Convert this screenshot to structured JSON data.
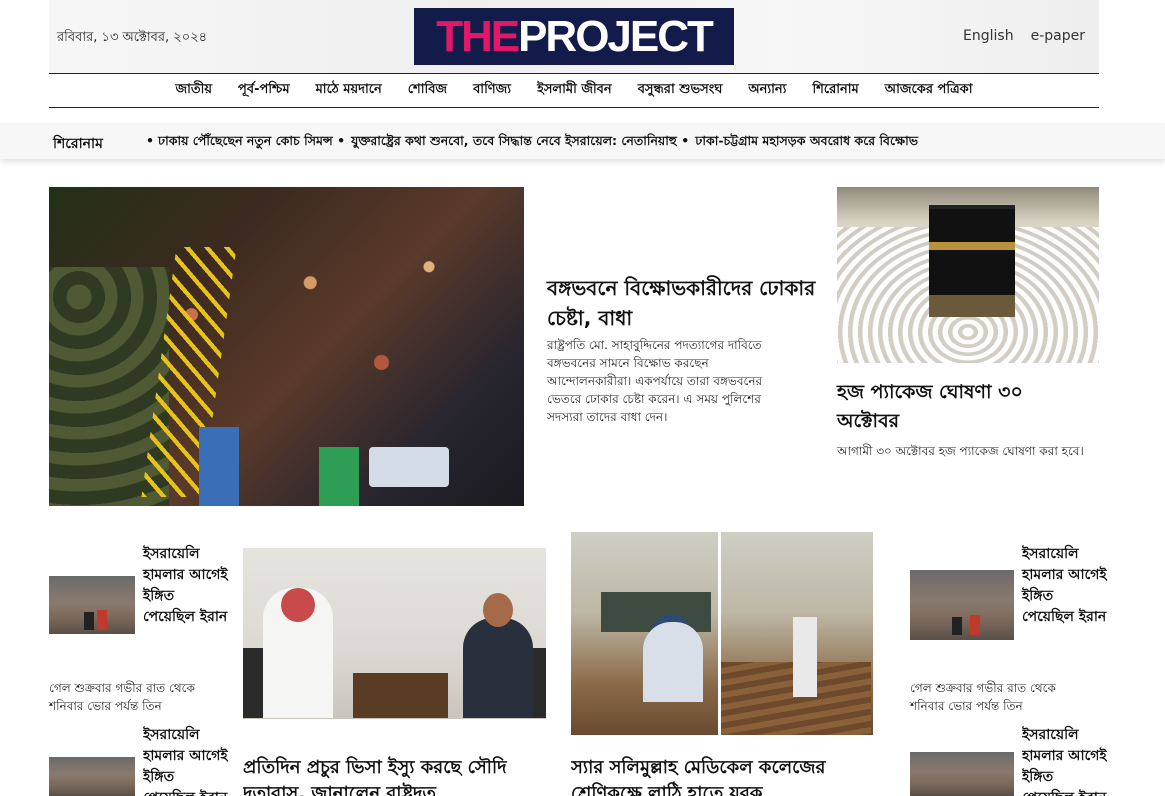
{
  "header": {
    "date": "রবিবার, ১৩ অক্টোবর, ২০২৪",
    "logo_the": "THE",
    "logo_project": "PROJECT",
    "links": [
      "English",
      "e-paper"
    ]
  },
  "nav": [
    "জাতীয়",
    "পূর্ব-পশ্চিম",
    "মাঠে ময়দানে",
    "শোবিজ",
    "বাণিজ্য",
    "ইসলামী জীবন",
    "বসুন্ধরা শুভসংঘ",
    "অন্যান্য",
    "শিরোনাম",
    "আজকের পত্রিকা"
  ],
  "ticker": {
    "label": "শিরোনাম",
    "items": [
      "ঢাকায় পৌঁছেছেন নতুন কোচ সিমন্স",
      "যুক্তরাষ্ট্রের কথা শুনবো, তবে সিদ্ধান্ত নেবে ইসরায়েল: নেতানিয়াহু",
      "ঢাকা-চট্টগ্রাম মহাসড়ক অবরোধ করে বিক্ষোভ"
    ]
  },
  "lead": {
    "title": "বঙ্গভবনে বিক্ষোভকারীদের ঢোকার চেষ্টা, বাধা",
    "summary": "রাষ্ট্রপতি মো. সাহাবুদ্দিনের পদত্যাগের দাবিতে বঙ্গভবনের সামনে বিক্ষোভ করছেন আন্দোলনকারীরা। একপর্যায়ে তারা বঙ্গভবনের ভেতরে ঢোকার চেষ্টা করেন। এ সময় পুলিশের সদস্যরা তাদের বাধা দেন।"
  },
  "side": {
    "title": "হজ প্যাকেজ ঘোষণা ৩০ অক্টোবর",
    "summary": "আগামী ৩০ অক্টোবর হজ প্যাকেজ ঘোষণা করা হবে।"
  },
  "small_story": {
    "title": "ইসরায়েলি হামলার আগেই ইঙ্গিত পেয়েছিল ইরান",
    "summary": "গেল শুক্রবার গভীর রাত থেকে শনিবার ভোর পর্যন্ত তিন"
  },
  "mid_left": {
    "title": "প্রতিদিন প্রচুর ভিসা ইস্যু করছে সৌদি দূতাবাস, জানালেন রাষ্ট্রদূত"
  },
  "mid_right": {
    "title": "স্যার সলিমুল্লাহ মেডিকেল কলেজের শ্রেণিকক্ষে লাঠি হাতে যুবক"
  }
}
